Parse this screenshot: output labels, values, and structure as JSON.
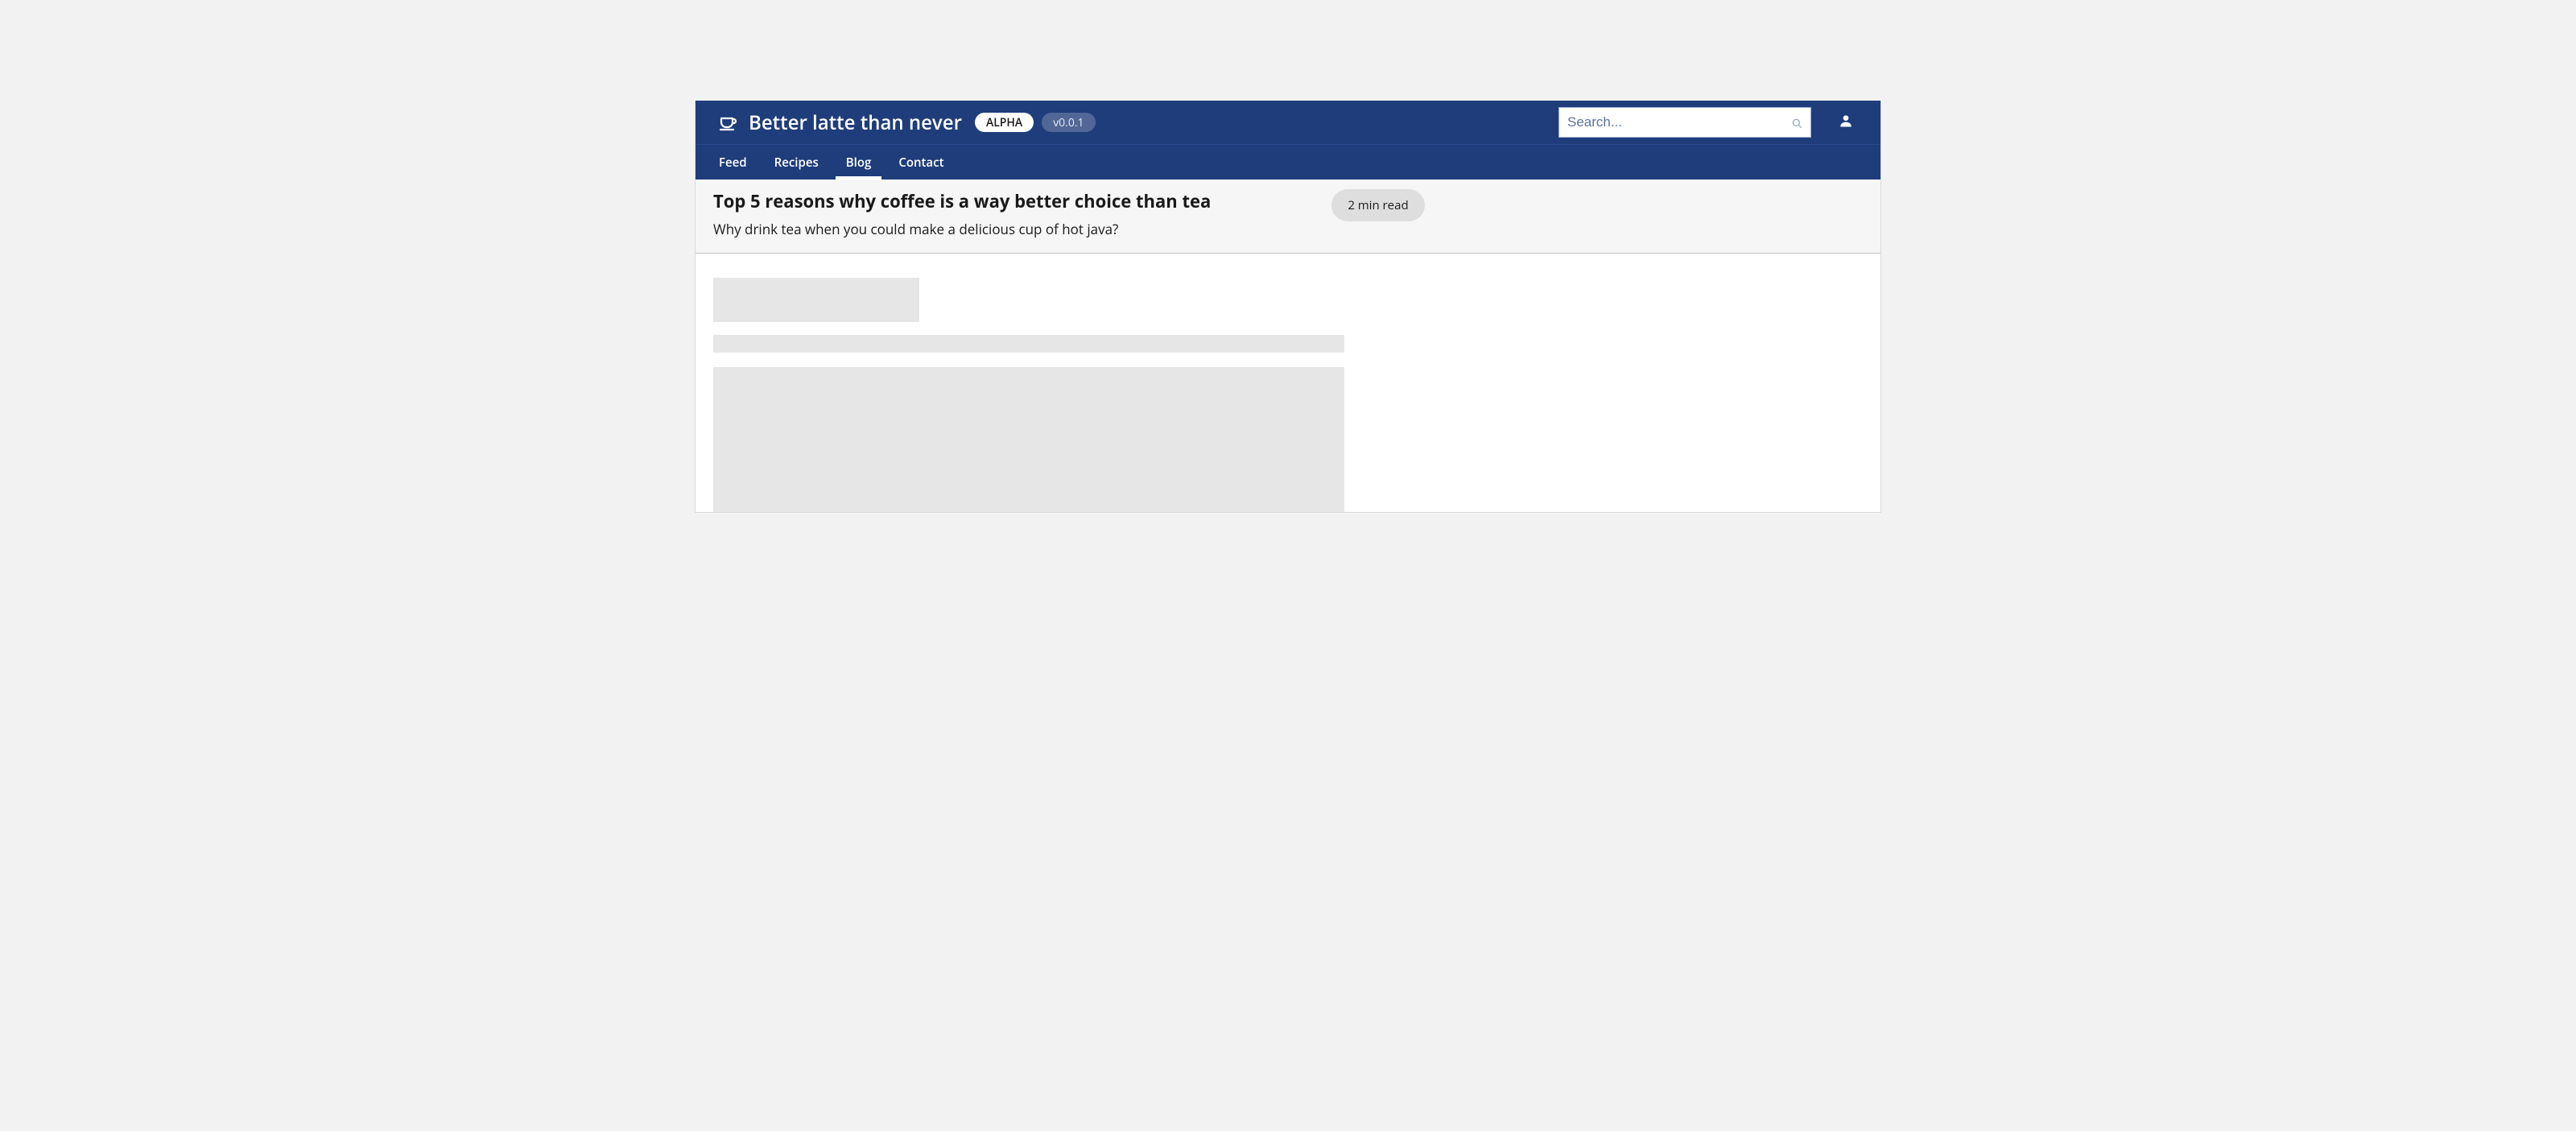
{
  "brand": {
    "title": "Better latte than never",
    "primary_badge": "ALPHA",
    "version_badge": "v0.0.1"
  },
  "search": {
    "placeholder": "Search..."
  },
  "nav": {
    "items": [
      {
        "label": "Feed",
        "active": false
      },
      {
        "label": "Recipes",
        "active": false
      },
      {
        "label": "Blog",
        "active": true
      },
      {
        "label": "Contact",
        "active": false
      }
    ]
  },
  "page": {
    "title": "Top 5 reasons why coffee is a way better choice than tea",
    "subtitle": "Why drink tea when you could make a delicious cup of hot java?",
    "read_time": "2 min read"
  }
}
